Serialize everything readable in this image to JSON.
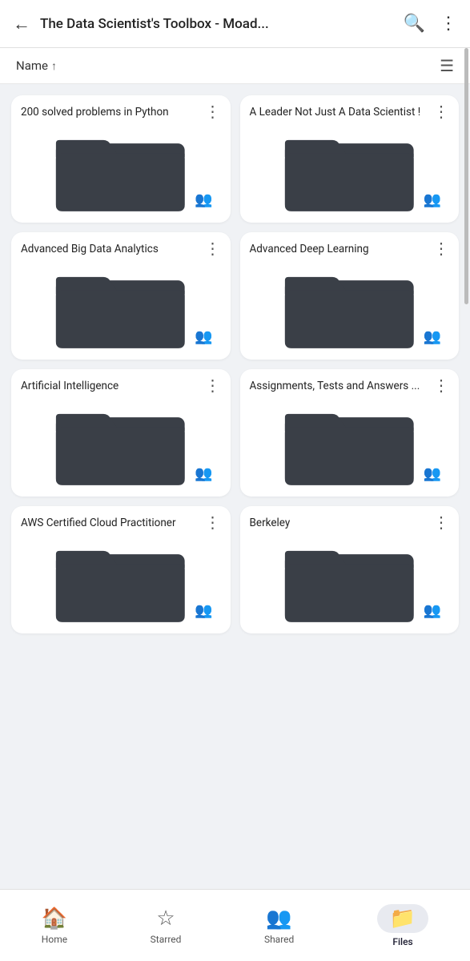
{
  "header": {
    "back_label": "←",
    "title": "The Data Scientist's Toolbox - Moad...",
    "search_icon": "🔍",
    "more_icon": "⋮"
  },
  "sort_bar": {
    "name_label": "Name",
    "arrow": "↑",
    "list_icon": "☰"
  },
  "folders": [
    {
      "id": 1,
      "name": "200 solved problems in Python"
    },
    {
      "id": 2,
      "name": "A Leader Not Just A Data Scientist !"
    },
    {
      "id": 3,
      "name": "Advanced Big Data Analytics"
    },
    {
      "id": 4,
      "name": "Advanced Deep Learning"
    },
    {
      "id": 5,
      "name": "Artificial Intelligence"
    },
    {
      "id": 6,
      "name": "Assignments, Tests and Answers ..."
    },
    {
      "id": 7,
      "name": "AWS  Certified Cloud Practitioner"
    },
    {
      "id": 8,
      "name": "Berkeley"
    }
  ],
  "bottom_nav": {
    "items": [
      {
        "id": "home",
        "label": "Home",
        "icon": "🏠",
        "active": false
      },
      {
        "id": "starred",
        "label": "Starred",
        "icon": "☆",
        "active": false
      },
      {
        "id": "shared",
        "label": "Shared",
        "icon": "👥",
        "active": false
      },
      {
        "id": "files",
        "label": "Files",
        "icon": "📁",
        "active": true
      }
    ]
  }
}
